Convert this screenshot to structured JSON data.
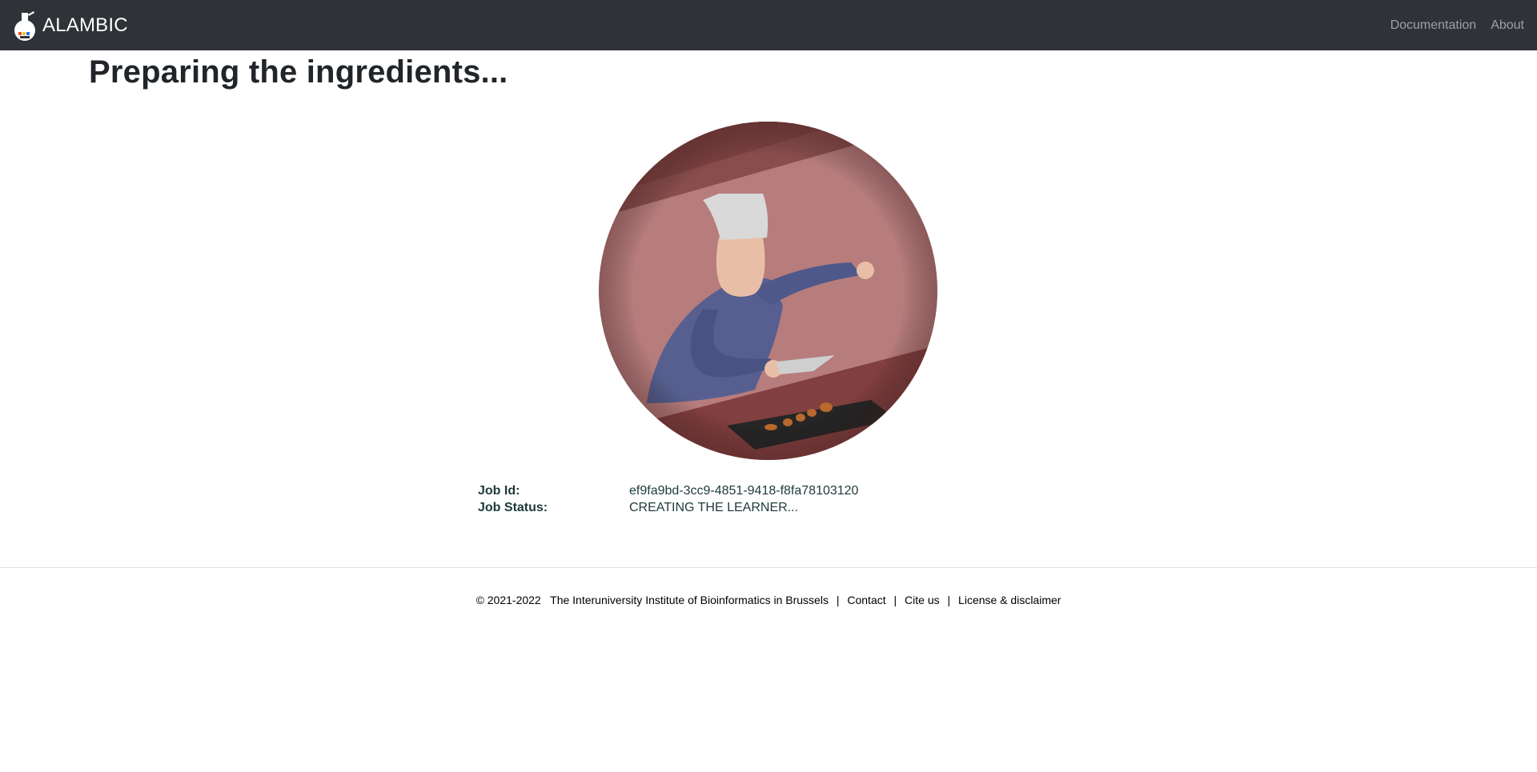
{
  "navbar": {
    "brand": "ALAMBIC",
    "links": [
      "Documentation",
      "About"
    ]
  },
  "page": {
    "title": "Preparing the ingredients..."
  },
  "job": {
    "id_label": "Job Id:",
    "id_value": "ef9fa9bd-3cc9-4851-9418-f8fa78103120",
    "status_label": "Job Status:",
    "status_value": "CREATING THE LEARNER..."
  },
  "footer": {
    "copyright": "© 2021-2022",
    "institute": "The Interuniversity Institute of Bioinformatics in Brussels",
    "contact": "Contact",
    "cite": "Cite us",
    "license": "License & disclaimer",
    "separator": "|"
  },
  "colors": {
    "navbar_bg": "#2f3337",
    "nav_link": "#9ba1a6",
    "illustration_wall": "#b77c7c",
    "illustration_dark": "#7e3f3f",
    "chef_shirt": "#565f8f",
    "chef_hat": "#d9d9d9",
    "skin": "#e8bfa6"
  },
  "icons": {
    "brand_logo": "alembic-flask-icon"
  }
}
